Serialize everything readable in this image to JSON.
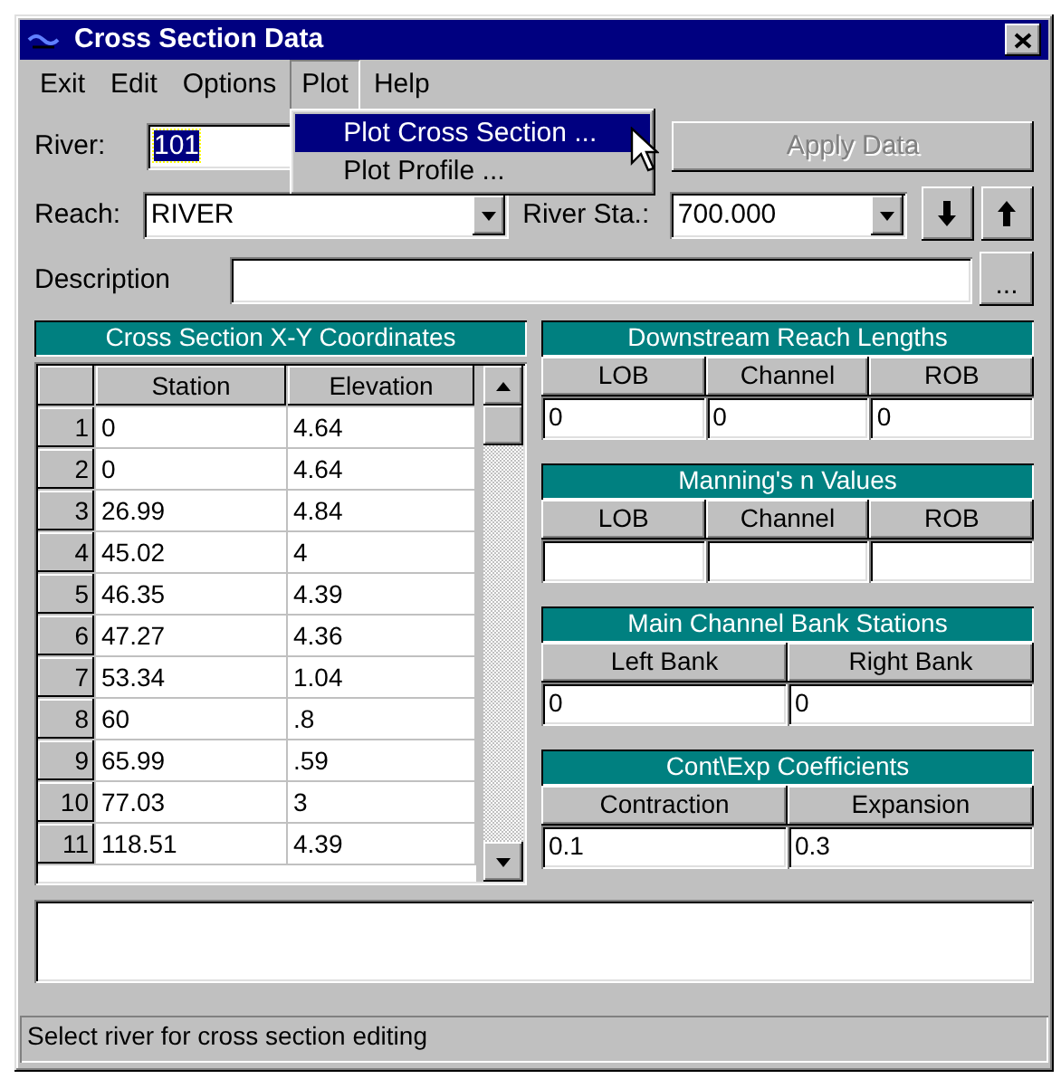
{
  "window": {
    "title": "Cross Section Data"
  },
  "menu": [
    {
      "label": "Exit",
      "selected": false
    },
    {
      "label": "Edit",
      "selected": false
    },
    {
      "label": "Options",
      "selected": false
    },
    {
      "label": "Plot",
      "selected": true
    },
    {
      "label": "Help",
      "selected": false
    }
  ],
  "open_menu": [
    {
      "label": "Plot Cross Section ...",
      "selected": true
    },
    {
      "label": "Plot Profile ...",
      "selected": false
    }
  ],
  "river": {
    "label": "River:",
    "value": "101",
    "focused": true
  },
  "apply_button": {
    "label": "Apply Data",
    "disabled": true
  },
  "reach": {
    "label": "Reach:",
    "value": "RIVER"
  },
  "river_station": {
    "label": "River Sta.:",
    "value": "700.000"
  },
  "description": {
    "label": "Description",
    "button": "..."
  },
  "xy_table": {
    "title": "Cross Section X-Y Coordinates",
    "columns": [
      "Station",
      "Elevation"
    ],
    "rows": [
      {
        "number": "1",
        "station": "0",
        "elevation": "4.64"
      },
      {
        "number": "2",
        "station": "0",
        "elevation": "4.64"
      },
      {
        "number": "3",
        "station": "26.99",
        "elevation": "4.84"
      },
      {
        "number": "4",
        "station": "45.02",
        "elevation": "4"
      },
      {
        "number": "5",
        "station": "46.35",
        "elevation": "4.39"
      },
      {
        "number": "6",
        "station": "47.27",
        "elevation": "4.36"
      },
      {
        "number": "7",
        "station": "53.34",
        "elevation": "1.04"
      },
      {
        "number": "8",
        "station": "60",
        "elevation": ".8"
      },
      {
        "number": "9",
        "station": "65.99",
        "elevation": ".59"
      },
      {
        "number": "10",
        "station": "77.03",
        "elevation": "3"
      },
      {
        "number": "11",
        "station": "118.51",
        "elevation": "4.39"
      }
    ]
  },
  "panels": [
    {
      "title": "Downstream Reach Lengths",
      "fields": [
        {
          "column": "LOB",
          "value": "0"
        },
        {
          "column": "Channel",
          "value": "0"
        },
        {
          "column": "ROB",
          "value": "0"
        }
      ]
    },
    {
      "title": "Manning's n Values",
      "fields": [
        {
          "column": "LOB"
        },
        {
          "column": "Channel"
        },
        {
          "column": "ROB"
        }
      ]
    },
    {
      "title": "Main Channel Bank Stations",
      "fields": [
        {
          "column": "Left Bank",
          "value": "0"
        },
        {
          "column": "Right Bank",
          "value": "0"
        }
      ]
    },
    {
      "title": "Cont\\Exp  Coefficients",
      "fields": [
        {
          "column": "Contraction",
          "value": "0.1"
        },
        {
          "column": "Expansion",
          "value": "0.3"
        }
      ]
    }
  ],
  "status_bar": "Select river for cross section editing"
}
